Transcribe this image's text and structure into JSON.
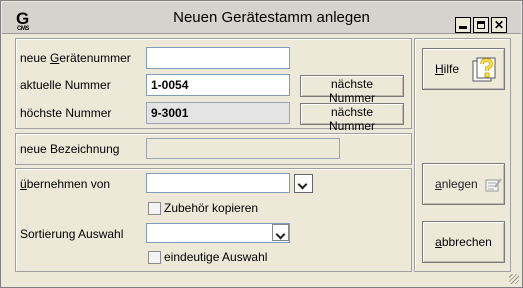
{
  "window": {
    "title": "Neuen Gerätestamm anlegen",
    "icon_glyph": "G",
    "icon_sub": "CMS"
  },
  "form": {
    "neue_nummer": {
      "label_pre": "neue ",
      "label_mn": "G",
      "label_post": "erätenummer",
      "value": ""
    },
    "aktuelle_nummer": {
      "label": "aktuelle Nummer",
      "value": "1-0054",
      "button": "nächste Nummer"
    },
    "hoechste_nummer": {
      "label": "höchste Nummer",
      "value": "9-3001",
      "button": "nächste Nummer"
    },
    "bezeichnung": {
      "label": "neue Bezeichnung",
      "value": ""
    },
    "uebernehmen": {
      "label_mn": "ü",
      "label_post": "bernehmen von",
      "value": ""
    },
    "zubehoer": {
      "label": "Zubehör kopieren",
      "checked": false
    },
    "sortierung": {
      "label": "Sortierung Auswahl",
      "value": ""
    },
    "eindeutig": {
      "label": "eindeutige Auswahl",
      "checked": false
    }
  },
  "actions": {
    "hilfe": {
      "mn": "H",
      "rest": "ilfe"
    },
    "anlegen": {
      "mn": "a",
      "rest": "nlegen"
    },
    "abbrechen": {
      "mn": "a",
      "rest": "bbrechen"
    }
  }
}
